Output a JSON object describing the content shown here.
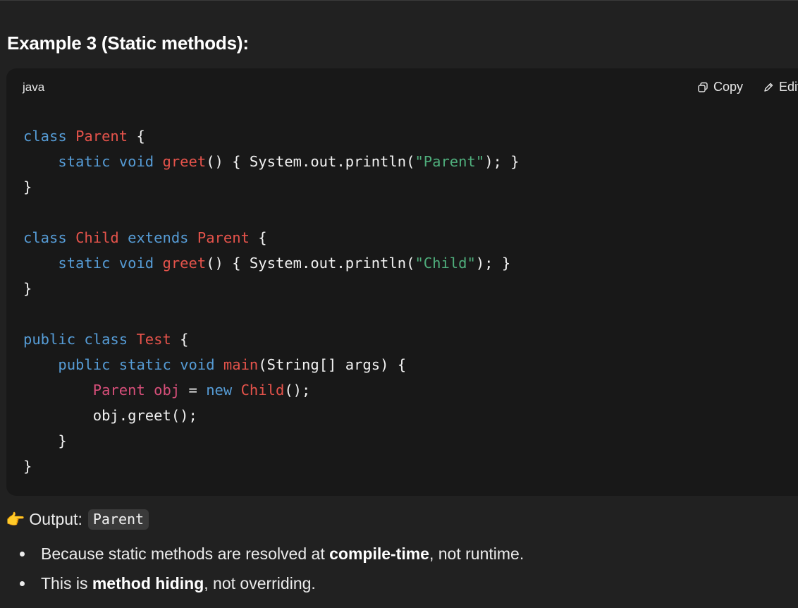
{
  "heading": "Example 3 (Static methods):",
  "code_block": {
    "language": "java",
    "copy_label": "Copy",
    "edit_label": "Edit",
    "lines": [
      [
        {
          "t": "class",
          "c": "kw"
        },
        {
          "t": " "
        },
        {
          "t": "Parent",
          "c": "ty"
        },
        {
          "t": " {"
        }
      ],
      [
        {
          "t": "    "
        },
        {
          "t": "static",
          "c": "kw"
        },
        {
          "t": " "
        },
        {
          "t": "void",
          "c": "kw"
        },
        {
          "t": " "
        },
        {
          "t": "greet",
          "c": "fn"
        },
        {
          "t": "() { System.out.println("
        },
        {
          "t": "\"Parent\"",
          "c": "st"
        },
        {
          "t": "); }"
        }
      ],
      [
        {
          "t": "}"
        }
      ],
      [],
      [
        {
          "t": "class",
          "c": "kw"
        },
        {
          "t": " "
        },
        {
          "t": "Child",
          "c": "ty"
        },
        {
          "t": " "
        },
        {
          "t": "extends",
          "c": "kw"
        },
        {
          "t": " "
        },
        {
          "t": "Parent",
          "c": "ty"
        },
        {
          "t": " {"
        }
      ],
      [
        {
          "t": "    "
        },
        {
          "t": "static",
          "c": "kw"
        },
        {
          "t": " "
        },
        {
          "t": "void",
          "c": "kw"
        },
        {
          "t": " "
        },
        {
          "t": "greet",
          "c": "fn"
        },
        {
          "t": "() { System.out.println("
        },
        {
          "t": "\"Child\"",
          "c": "st"
        },
        {
          "t": "); }"
        }
      ],
      [
        {
          "t": "}"
        }
      ],
      [],
      [
        {
          "t": "public",
          "c": "kw"
        },
        {
          "t": " "
        },
        {
          "t": "class",
          "c": "kw"
        },
        {
          "t": " "
        },
        {
          "t": "Test",
          "c": "ty"
        },
        {
          "t": " {"
        }
      ],
      [
        {
          "t": "    "
        },
        {
          "t": "public",
          "c": "kw"
        },
        {
          "t": " "
        },
        {
          "t": "static",
          "c": "kw"
        },
        {
          "t": " "
        },
        {
          "t": "void",
          "c": "kw"
        },
        {
          "t": " "
        },
        {
          "t": "main",
          "c": "fn"
        },
        {
          "t": "(String[] args) {"
        }
      ],
      [
        {
          "t": "        "
        },
        {
          "t": "Parent",
          "c": "vr"
        },
        {
          "t": " "
        },
        {
          "t": "obj",
          "c": "vr"
        },
        {
          "t": " = "
        },
        {
          "t": "new",
          "c": "kw"
        },
        {
          "t": " "
        },
        {
          "t": "Child",
          "c": "ty"
        },
        {
          "t": "();"
        }
      ],
      [
        {
          "t": "        obj.greet();"
        }
      ],
      [
        {
          "t": "    }"
        }
      ],
      [
        {
          "t": "}"
        }
      ]
    ]
  },
  "output": {
    "label": "Output:",
    "value": "Parent",
    "icon": "pointing-hand-icon"
  },
  "bullets": [
    {
      "before": "Because static methods are resolved at ",
      "bold": "compile-time",
      "after": ", not runtime."
    },
    {
      "before": "This is ",
      "bold": "method hiding",
      "after": ", not overriding."
    }
  ]
}
